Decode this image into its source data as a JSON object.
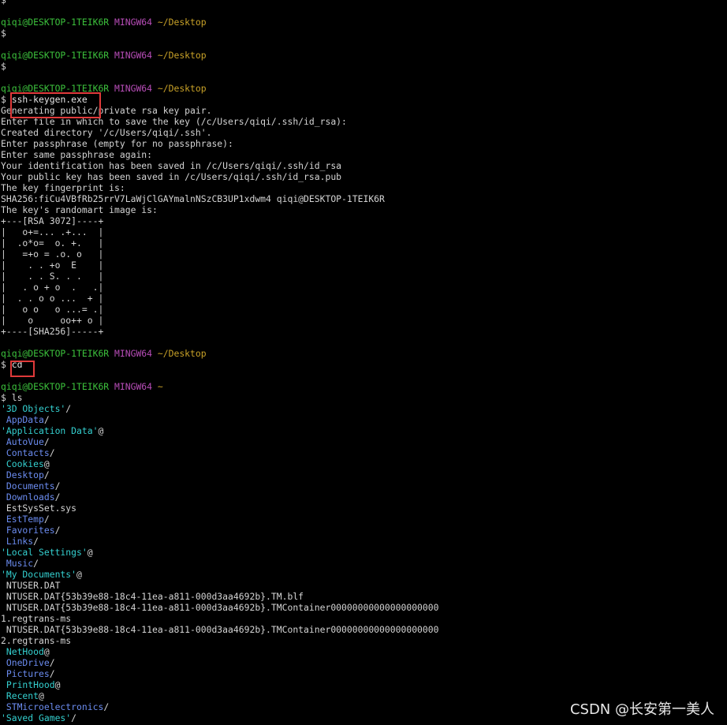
{
  "watermark": "CSDN @长安第一美人",
  "lines": [
    {
      "segs": [
        {
          "t": "$",
          "c": ""
        }
      ]
    },
    {
      "segs": [
        {
          "t": "",
          "c": ""
        }
      ]
    },
    {
      "segs": [
        {
          "t": "qiqi@DESKTOP-1TEIK6R",
          "c": "u"
        },
        {
          "t": " ",
          "c": ""
        },
        {
          "t": "MINGW64",
          "c": "h"
        },
        {
          "t": " ",
          "c": ""
        },
        {
          "t": "~/Desktop",
          "c": "p"
        }
      ]
    },
    {
      "segs": [
        {
          "t": "$",
          "c": ""
        }
      ]
    },
    {
      "segs": [
        {
          "t": "",
          "c": ""
        }
      ]
    },
    {
      "segs": [
        {
          "t": "qiqi@DESKTOP-1TEIK6R",
          "c": "u"
        },
        {
          "t": " ",
          "c": ""
        },
        {
          "t": "MINGW64",
          "c": "h"
        },
        {
          "t": " ",
          "c": ""
        },
        {
          "t": "~/Desktop",
          "c": "p"
        }
      ]
    },
    {
      "segs": [
        {
          "t": "$",
          "c": ""
        }
      ]
    },
    {
      "segs": [
        {
          "t": "",
          "c": ""
        }
      ]
    },
    {
      "segs": [
        {
          "t": "qiqi@DESKTOP-1TEIK6R",
          "c": "u"
        },
        {
          "t": " ",
          "c": ""
        },
        {
          "t": "MINGW64",
          "c": "h"
        },
        {
          "t": " ",
          "c": ""
        },
        {
          "t": "~/Desktop",
          "c": "p"
        }
      ]
    },
    {
      "segs": [
        {
          "t": "$ ",
          "c": ""
        },
        {
          "t": "ssh-keygen.exe",
          "c": "cmd"
        }
      ]
    },
    {
      "segs": [
        {
          "t": "Generating public/private rsa key pair.",
          "c": ""
        }
      ]
    },
    {
      "segs": [
        {
          "t": "Enter file in which to save the key (/c/Users/qiqi/.ssh/id_rsa):",
          "c": ""
        }
      ]
    },
    {
      "segs": [
        {
          "t": "Created directory '/c/Users/qiqi/.ssh'.",
          "c": ""
        }
      ]
    },
    {
      "segs": [
        {
          "t": "Enter passphrase (empty for no passphrase):",
          "c": ""
        }
      ]
    },
    {
      "segs": [
        {
          "t": "Enter same passphrase again:",
          "c": ""
        }
      ]
    },
    {
      "segs": [
        {
          "t": "Your identification has been saved in /c/Users/qiqi/.ssh/id_rsa",
          "c": ""
        }
      ]
    },
    {
      "segs": [
        {
          "t": "Your public key has been saved in /c/Users/qiqi/.ssh/id_rsa.pub",
          "c": ""
        }
      ]
    },
    {
      "segs": [
        {
          "t": "The key fingerprint is:",
          "c": ""
        }
      ]
    },
    {
      "segs": [
        {
          "t": "SHA256:fiCu4VBfRb25rrV7LaWjClGAYmalnNSzCB3UP1xdwm4 qiqi@DESKTOP-1TEIK6R",
          "c": ""
        }
      ]
    },
    {
      "segs": [
        {
          "t": "The key's randomart image is:",
          "c": ""
        }
      ]
    },
    {
      "segs": [
        {
          "t": "+---[RSA 3072]----+",
          "c": ""
        }
      ]
    },
    {
      "segs": [
        {
          "t": "|   o+=... .+...  |",
          "c": ""
        }
      ]
    },
    {
      "segs": [
        {
          "t": "|  .o*o=  o. +.   |",
          "c": ""
        }
      ]
    },
    {
      "segs": [
        {
          "t": "|   =+o = .o. o   |",
          "c": ""
        }
      ]
    },
    {
      "segs": [
        {
          "t": "|    . . +o  E    |",
          "c": ""
        }
      ]
    },
    {
      "segs": [
        {
          "t": "|    . . S. . .   |",
          "c": ""
        }
      ]
    },
    {
      "segs": [
        {
          "t": "|   . o + o  .   .|",
          "c": ""
        }
      ]
    },
    {
      "segs": [
        {
          "t": "|  . . o o ...  + |",
          "c": ""
        }
      ]
    },
    {
      "segs": [
        {
          "t": "|   o o   o ...= .|",
          "c": ""
        }
      ]
    },
    {
      "segs": [
        {
          "t": "|    o     oo++ o |",
          "c": ""
        }
      ]
    },
    {
      "segs": [
        {
          "t": "+----[SHA256]-----+",
          "c": ""
        }
      ]
    },
    {
      "segs": [
        {
          "t": "",
          "c": ""
        }
      ]
    },
    {
      "segs": [
        {
          "t": "qiqi@DESKTOP-1TEIK6R",
          "c": "u"
        },
        {
          "t": " ",
          "c": ""
        },
        {
          "t": "MINGW64",
          "c": "h"
        },
        {
          "t": " ",
          "c": ""
        },
        {
          "t": "~/Desktop",
          "c": "p"
        }
      ]
    },
    {
      "segs": [
        {
          "t": "$ ",
          "c": ""
        },
        {
          "t": "cd",
          "c": "cmd"
        }
      ]
    },
    {
      "segs": [
        {
          "t": "",
          "c": ""
        }
      ]
    },
    {
      "segs": [
        {
          "t": "qiqi@DESKTOP-1TEIK6R",
          "c": "u"
        },
        {
          "t": " ",
          "c": ""
        },
        {
          "t": "MINGW64",
          "c": "h"
        },
        {
          "t": " ",
          "c": ""
        },
        {
          "t": "~",
          "c": "p"
        }
      ]
    },
    {
      "segs": [
        {
          "t": "$ ls",
          "c": ""
        }
      ]
    },
    {
      "segs": [
        {
          "t": "'3D Objects'",
          "c": "lnk"
        },
        {
          "t": "/",
          "c": ""
        }
      ]
    },
    {
      "segs": [
        {
          "t": " ",
          "c": ""
        },
        {
          "t": "AppData",
          "c": "dir"
        },
        {
          "t": "/",
          "c": ""
        }
      ]
    },
    {
      "segs": [
        {
          "t": "'Application Data'",
          "c": "lnk"
        },
        {
          "t": "@",
          "c": ""
        }
      ]
    },
    {
      "segs": [
        {
          "t": " ",
          "c": ""
        },
        {
          "t": "AutoVue",
          "c": "dir"
        },
        {
          "t": "/",
          "c": ""
        }
      ]
    },
    {
      "segs": [
        {
          "t": " ",
          "c": ""
        },
        {
          "t": "Contacts",
          "c": "dir"
        },
        {
          "t": "/",
          "c": ""
        }
      ]
    },
    {
      "segs": [
        {
          "t": " ",
          "c": ""
        },
        {
          "t": "Cookies",
          "c": "lnk"
        },
        {
          "t": "@",
          "c": ""
        }
      ]
    },
    {
      "segs": [
        {
          "t": " ",
          "c": ""
        },
        {
          "t": "Desktop",
          "c": "dir"
        },
        {
          "t": "/",
          "c": ""
        }
      ]
    },
    {
      "segs": [
        {
          "t": " ",
          "c": ""
        },
        {
          "t": "Documents",
          "c": "dir"
        },
        {
          "t": "/",
          "c": ""
        }
      ]
    },
    {
      "segs": [
        {
          "t": " ",
          "c": ""
        },
        {
          "t": "Downloads",
          "c": "dir"
        },
        {
          "t": "/",
          "c": ""
        }
      ]
    },
    {
      "segs": [
        {
          "t": " EstSysSet.sys",
          "c": ""
        }
      ]
    },
    {
      "segs": [
        {
          "t": " ",
          "c": ""
        },
        {
          "t": "EstTemp",
          "c": "dir"
        },
        {
          "t": "/",
          "c": ""
        }
      ]
    },
    {
      "segs": [
        {
          "t": " ",
          "c": ""
        },
        {
          "t": "Favorites",
          "c": "dir"
        },
        {
          "t": "/",
          "c": ""
        }
      ]
    },
    {
      "segs": [
        {
          "t": " ",
          "c": ""
        },
        {
          "t": "Links",
          "c": "dir"
        },
        {
          "t": "/",
          "c": ""
        }
      ]
    },
    {
      "segs": [
        {
          "t": "'Local Settings'",
          "c": "lnk"
        },
        {
          "t": "@",
          "c": ""
        }
      ]
    },
    {
      "segs": [
        {
          "t": " ",
          "c": ""
        },
        {
          "t": "Music",
          "c": "dir"
        },
        {
          "t": "/",
          "c": ""
        }
      ]
    },
    {
      "segs": [
        {
          "t": "'My Documents'",
          "c": "lnk"
        },
        {
          "t": "@",
          "c": ""
        }
      ]
    },
    {
      "segs": [
        {
          "t": " NTUSER.DAT",
          "c": ""
        }
      ]
    },
    {
      "segs": [
        {
          "t": " NTUSER.DAT{53b39e88-18c4-11ea-a811-000d3aa4692b}.TM.blf",
          "c": ""
        }
      ]
    },
    {
      "segs": [
        {
          "t": " NTUSER.DAT{53b39e88-18c4-11ea-a811-000d3aa4692b}.TMContainer00000000000000000000",
          "c": ""
        }
      ]
    },
    {
      "segs": [
        {
          "t": "1.regtrans-ms",
          "c": ""
        }
      ]
    },
    {
      "segs": [
        {
          "t": " NTUSER.DAT{53b39e88-18c4-11ea-a811-000d3aa4692b}.TMContainer00000000000000000000",
          "c": ""
        }
      ]
    },
    {
      "segs": [
        {
          "t": "2.regtrans-ms",
          "c": ""
        }
      ]
    },
    {
      "segs": [
        {
          "t": " ",
          "c": ""
        },
        {
          "t": "NetHood",
          "c": "lnk"
        },
        {
          "t": "@",
          "c": ""
        }
      ]
    },
    {
      "segs": [
        {
          "t": " ",
          "c": ""
        },
        {
          "t": "OneDrive",
          "c": "dir"
        },
        {
          "t": "/",
          "c": ""
        }
      ]
    },
    {
      "segs": [
        {
          "t": " ",
          "c": ""
        },
        {
          "t": "Pictures",
          "c": "dir"
        },
        {
          "t": "/",
          "c": ""
        }
      ]
    },
    {
      "segs": [
        {
          "t": " ",
          "c": ""
        },
        {
          "t": "PrintHood",
          "c": "lnk"
        },
        {
          "t": "@",
          "c": ""
        }
      ]
    },
    {
      "segs": [
        {
          "t": " ",
          "c": ""
        },
        {
          "t": "Recent",
          "c": "lnk"
        },
        {
          "t": "@",
          "c": ""
        }
      ]
    },
    {
      "segs": [
        {
          "t": " ",
          "c": ""
        },
        {
          "t": "STMicroelectronics",
          "c": "dir"
        },
        {
          "t": "/",
          "c": ""
        }
      ]
    },
    {
      "segs": [
        {
          "t": "'Saved Games'",
          "c": "lnk"
        },
        {
          "t": "/",
          "c": ""
        }
      ]
    }
  ]
}
